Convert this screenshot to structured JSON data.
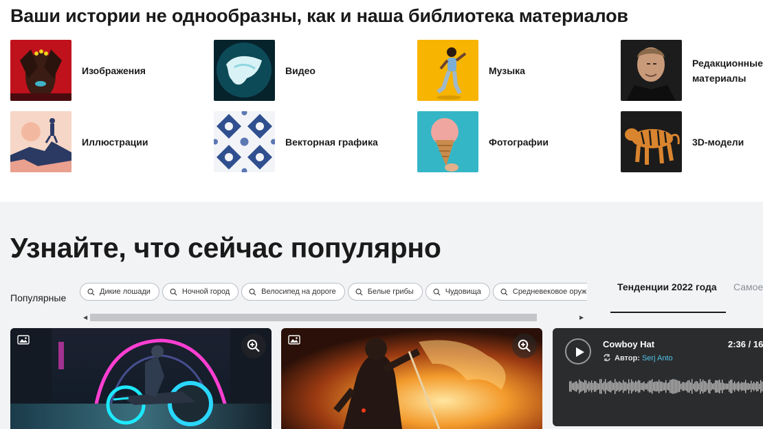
{
  "categories_section": {
    "title": "Ваши истории не однообразны, как и наша библиотека материалов",
    "items": [
      {
        "label": "Изображения",
        "icon": "woman-hands-over-face-thumb"
      },
      {
        "label": "Видео",
        "icon": "underwater-fabric-thumb"
      },
      {
        "label": "Музыка",
        "icon": "dancing-woman-yellow-thumb"
      },
      {
        "label": "Редакционные\nматериалы",
        "icon": "celebrity-portrait-thumb"
      },
      {
        "label": "Иллюстрации",
        "icon": "hiker-on-mountain-thumb"
      },
      {
        "label": "Векторная графика",
        "icon": "blue-ornament-pattern-thumb"
      },
      {
        "label": "Фотографии",
        "icon": "ice-cream-cone-thumb"
      },
      {
        "label": "3D-модели",
        "icon": "tiger-thumb"
      }
    ]
  },
  "trending_section": {
    "title": "Узнайте, что сейчас популярно",
    "popular_label": "Популярные",
    "chips": [
      "Дикие лошади",
      "Ночной город",
      "Велосипед на дороге",
      "Белые грибы",
      "Чудовища",
      "Средневековое оружие"
    ],
    "tabs": {
      "active": "Тенденции 2022 года",
      "inactive": "Самое"
    },
    "cards": [
      {
        "badge_icon": "image-type-icon",
        "zoom_icon": "zoom-in-icon",
        "subject": "cyberpunk-motorcycle-rider"
      },
      {
        "badge_icon": "image-type-icon",
        "zoom_icon": "zoom-in-icon",
        "subject": "samurai-fire-dragon"
      }
    ],
    "audio": {
      "title": "Cowboy Hat",
      "author_label": "Автор:",
      "author_name": "Serj Anto",
      "duration": "2:36 / 16",
      "play_icon": "play-icon"
    }
  },
  "colors": {
    "accent_link": "#4fc3e8",
    "section_bg": "#f2f3f5",
    "audio_bg": "#2b2c2e"
  }
}
